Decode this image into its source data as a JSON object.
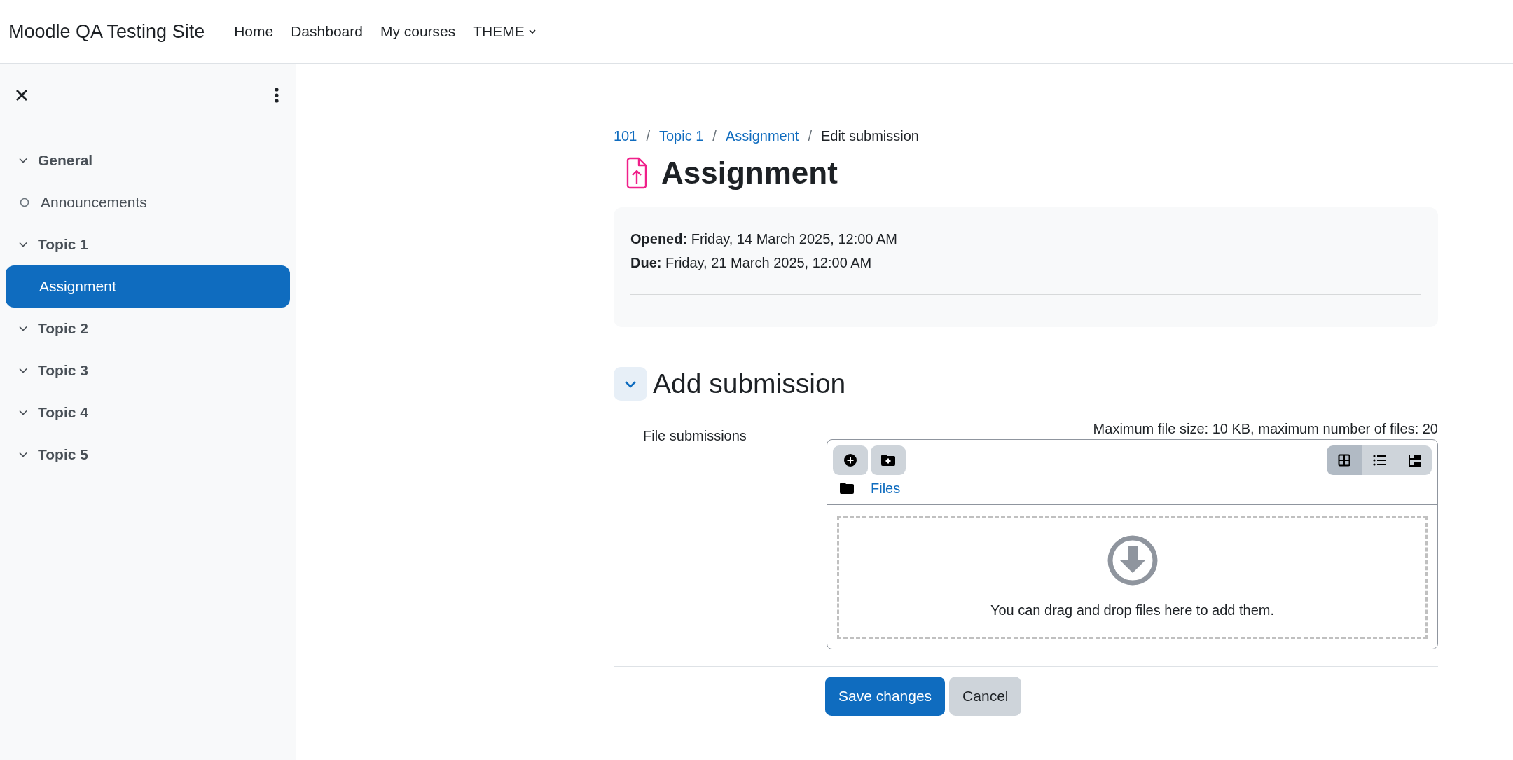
{
  "site_name": "Moodle QA Testing Site",
  "nav_links": [
    {
      "label": "Home",
      "kind": "link"
    },
    {
      "label": "Dashboard",
      "kind": "link"
    },
    {
      "label": "My courses",
      "kind": "link"
    },
    {
      "label": "THEME",
      "kind": "dropdown"
    }
  ],
  "sidebar": {
    "items": [
      {
        "label": "General",
        "kind": "section",
        "expanded": true,
        "children": [
          {
            "label": "Announcements",
            "kind": "activity",
            "selected": false
          }
        ]
      },
      {
        "label": "Topic 1",
        "kind": "section",
        "expanded": true,
        "children": [
          {
            "label": "Assignment",
            "kind": "activity",
            "selected": true
          }
        ]
      },
      {
        "label": "Topic 2",
        "kind": "section",
        "expanded": true
      },
      {
        "label": "Topic 3",
        "kind": "section",
        "expanded": true
      },
      {
        "label": "Topic 4",
        "kind": "section",
        "expanded": true
      },
      {
        "label": "Topic 5",
        "kind": "section",
        "expanded": true
      }
    ]
  },
  "breadcrumb": [
    {
      "label": "101",
      "kind": "link"
    },
    {
      "label": "/",
      "kind": "separator"
    },
    {
      "label": "Topic 1",
      "kind": "link"
    },
    {
      "label": "/",
      "kind": "separator"
    },
    {
      "label": "Assignment",
      "kind": "link"
    },
    {
      "label": "/",
      "kind": "separator"
    },
    {
      "label": "Edit submission",
      "kind": "current"
    }
  ],
  "heading": "Assignment",
  "dates": [
    "**Opened:** Friday, 14 March 2025, 12:00 AM",
    "**Due:** Friday, 21 March 2025, 12:00 AM"
  ],
  "section": {
    "title": "Add submission",
    "expanded": true
  },
  "field": {
    "label": "File submissions",
    "limits": "Maximum file size: 10 KB, maximum number of files: 20",
    "views": [
      {
        "kind": "icons",
        "selected": true
      },
      {
        "kind": "list",
        "selected": false
      },
      {
        "kind": "tree",
        "selected": false
      }
    ],
    "path": "Files",
    "drop_text": "You can drag and drop files here to add them."
  },
  "buttons": [
    {
      "label": "Save changes",
      "kind": "primary"
    },
    {
      "label": "Cancel",
      "kind": "secondary"
    }
  ]
}
